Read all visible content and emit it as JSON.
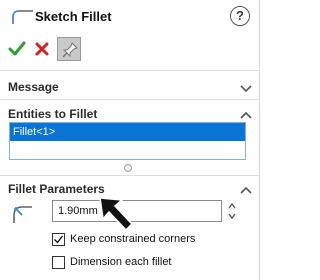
{
  "header": {
    "title": "Sketch Fillet",
    "help_label": "?"
  },
  "toolbar": {
    "ok_icon": "checkmark-icon",
    "cancel_icon": "x-icon",
    "pin_icon": "pushpin-icon"
  },
  "sections": {
    "message": {
      "title": "Message",
      "state": "collapsed"
    },
    "entities": {
      "title": "Entities to Fillet",
      "state": "expanded",
      "items": [
        "Fillet<1>"
      ],
      "selected_index": 0
    },
    "fillet_parameters": {
      "title": "Fillet Parameters",
      "state": "expanded",
      "radius_value": "1.90mm",
      "keep_corners_label": "Keep constrained corners",
      "keep_corners_checked": true,
      "dimension_each_label": "Dimension each fillet",
      "dimension_each_checked": false
    }
  },
  "colors": {
    "accept_green": "#2e9e2e",
    "cancel_red": "#d42020",
    "selection_blue": "#0a74d6"
  }
}
